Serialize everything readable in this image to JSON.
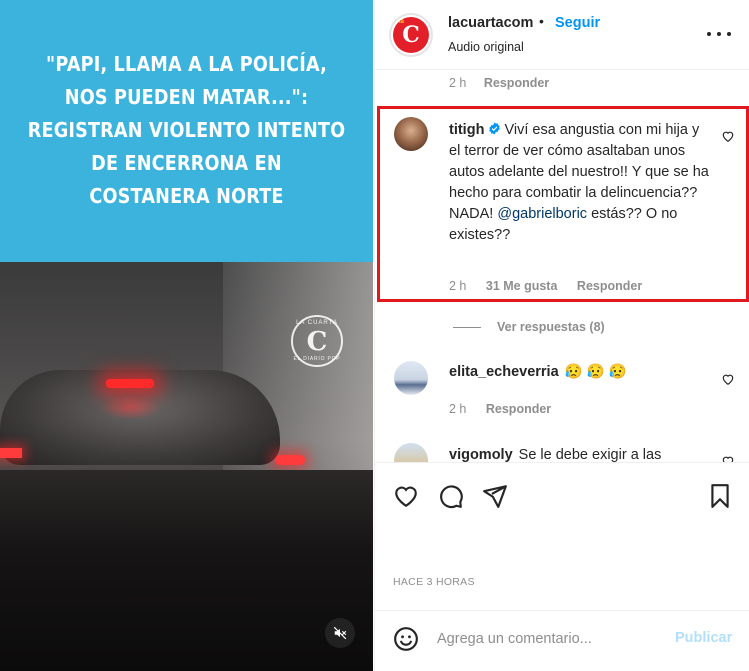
{
  "media": {
    "headline_lines": [
      "\"PAPI, LLAMA A LA POLICÍA,",
      "NOS PUEDEN MATAR...\":",
      "REGISTRAN VIOLENTO INTENTO",
      "DE ENCERRONA EN",
      "COSTANERA NORTE"
    ],
    "watermark_letter": "C",
    "watermark_top": "LA CUARTA",
    "watermark_bottom": "EL DIARIO POP",
    "mute_icon": "speaker-muted-icon"
  },
  "post_header": {
    "username": "lacuartacom",
    "separator": "•",
    "follow_label": "Seguir",
    "audio_label": "Audio original",
    "avatar_letter": "C",
    "avatar_small": "la"
  },
  "comments": {
    "prev_meta": {
      "time": "2 h",
      "reply": "Responder"
    },
    "items": [
      {
        "user": "titigh",
        "verified": true,
        "text": "Viví esa angustia con mi hija y el terror de ver cómo asaltaban unos autos adelante del nuestro!! Y que se ha hecho para combatir la delincuencia?? NADA!",
        "mention": "@gabrielboric",
        "text_after": " estás?? O no existes??",
        "time": "2 h",
        "likes": "31 Me gusta",
        "reply": "Responder",
        "highlighted": true
      },
      {
        "user": "elita_echeverria",
        "text": "😥 😥 😥",
        "time": "2 h",
        "reply": "Responder"
      },
      {
        "user": "vigomoly",
        "text": "Se le debe exigir a las"
      }
    ],
    "view_replies": "Ver respuestas (8)"
  },
  "actions": {
    "icons": [
      "heart-icon",
      "comment-icon",
      "share-icon",
      "bookmark-icon"
    ],
    "time_ago": "HACE 3 HORAS"
  },
  "add_comment": {
    "placeholder": "Agrega un comentario...",
    "publish_label": "Publicar"
  },
  "colors": {
    "headline_bg": "#3cb3dc",
    "follow": "#0095f6",
    "highlight_border": "#e0191f",
    "mention": "#00376b",
    "brand_red": "#e3202a"
  }
}
